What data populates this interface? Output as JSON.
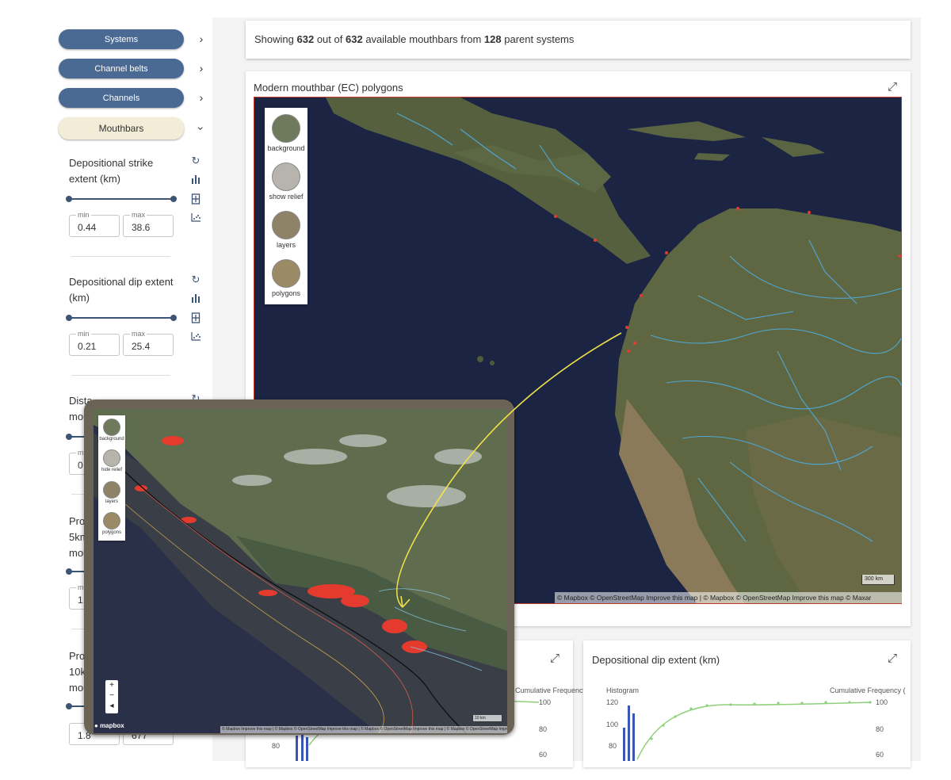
{
  "sidebar": {
    "nav": [
      {
        "label": "Systems"
      },
      {
        "label": "Channel belts"
      },
      {
        "label": "Channels"
      },
      {
        "label": "Mouthbars"
      }
    ],
    "filters": [
      {
        "title": "Depositional strike extent (km)",
        "min_label": "min",
        "max_label": "max",
        "min": "0.44",
        "max": "38.6"
      },
      {
        "title": "Depositional dip extent (km)",
        "min_label": "min",
        "max_label": "max",
        "min": "0.21",
        "max": "25.4"
      },
      {
        "title_partial_a": "Dista",
        "title_partial_b": "mou",
        "min_label": "mi",
        "min": "0"
      },
      {
        "title_partial_a": "Pro",
        "title_partial_b": "5km",
        "title_partial_c": "mou",
        "min_label": "mi",
        "min": "1."
      },
      {
        "title_partial_a": "Pro",
        "title_partial_b": "10k",
        "title_partial_c": "mou",
        "min": "1.8",
        "max": "677"
      }
    ]
  },
  "summary": {
    "prefix": "Showing",
    "shown": "632",
    "mid": "out of",
    "total": "632",
    "mid2": "available mouthbars from",
    "parents": "128",
    "suffix": "parent systems"
  },
  "map_card": {
    "title": "Modern mouthbar (EC) polygons",
    "controls": [
      {
        "label": "background"
      },
      {
        "label": "show relief"
      },
      {
        "label": "layers"
      },
      {
        "label": "polygons"
      }
    ],
    "scale": "300 km",
    "attribution": "© Mapbox © OpenStreetMap  Improve this map | © Mapbox © OpenStreetMap  Improve this map © Maxar"
  },
  "chart_cards": [
    {
      "title": "",
      "right_label": "Cumulative Frequency (",
      "y_ticks": [
        "80"
      ],
      "right_ticks": [
        "100",
        "80",
        "60"
      ]
    },
    {
      "title": "Depositional dip extent (km)",
      "left_label": "Histogram",
      "right_label": "Cumulative Frequency (",
      "y_ticks": [
        "120",
        "100",
        "80"
      ],
      "right_ticks": [
        "100",
        "80",
        "60"
      ]
    }
  ],
  "inset": {
    "controls": [
      {
        "label": "background"
      },
      {
        "label": "hide relief"
      },
      {
        "label": "layers"
      },
      {
        "label": "polygons"
      }
    ],
    "zoom": [
      "+",
      "−",
      "◂"
    ],
    "logo": "mapbox",
    "scale": "10 km",
    "attribution": "© Mapbox  Improve this map | © Mapbox © OpenStreetMap  Improve this map | © Mapbox © OpenStreetMap  Improve this map | © Mapbox © OpenStreetMap  Improve this map © Maxar"
  },
  "colors": {
    "nav_bg": "#4a6a93",
    "nav_active_bg": "#f3ecd6",
    "polygon_red": "#e53b2e",
    "arrow_yellow": "#f2e14a",
    "river_blue": "#4fa8d6",
    "hist_blue": "#3a55b5",
    "cum_green": "#8fd17a"
  },
  "icons": [
    "chevron-right-icon",
    "chevron-down-icon",
    "reset-icon",
    "bar-chart-icon",
    "filter-icon",
    "scatter-icon",
    "expand-icon"
  ]
}
